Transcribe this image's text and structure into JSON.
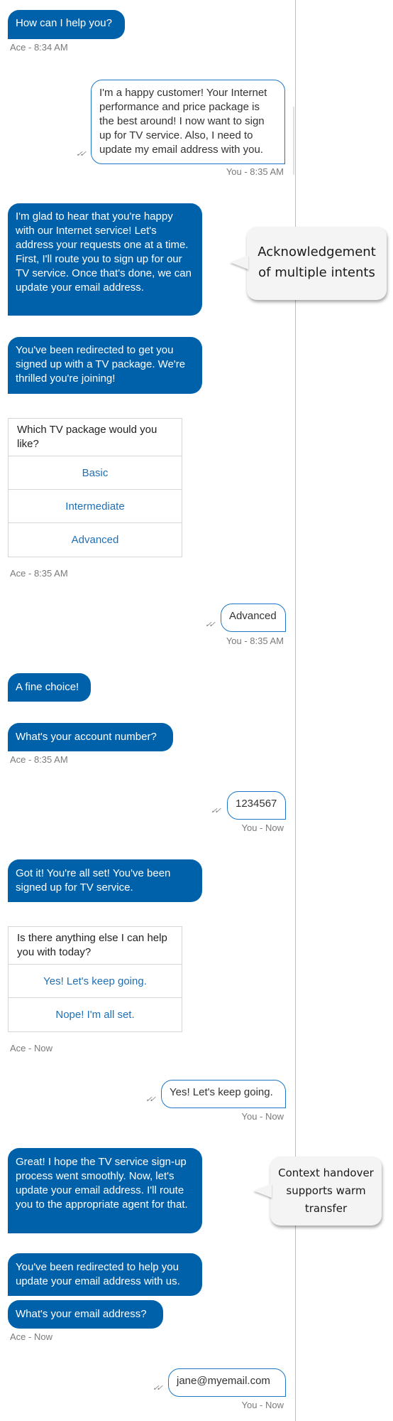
{
  "messages": {
    "m1": {
      "sender": "agent",
      "text": "How can I help you?",
      "meta": "Ace - 8:34 AM"
    },
    "m2": {
      "sender": "user",
      "text": "I'm a happy customer! Your Internet performance and price package is the best around! I now want to sign up for TV service. Also, I need to update my email address with you.",
      "meta": "You - 8:35 AM"
    },
    "m3": {
      "sender": "agent",
      "text": "I'm glad to hear that you're happy with our Internet service! Let's address your requests one at a time. First, I'll route you to sign up for our TV service. Once that's done, we can update your email address."
    },
    "m4": {
      "sender": "agent",
      "text": "You've been redirected to get you signed up with a TV package. We're thrilled you're joining!"
    },
    "card1": {
      "question": "Which TV package would you like?",
      "options": [
        "Basic",
        "Intermediate",
        "Advanced"
      ],
      "meta": "Ace - 8:35 AM"
    },
    "m5": {
      "sender": "user",
      "text": "Advanced",
      "meta": "You - 8:35 AM"
    },
    "m6": {
      "sender": "agent",
      "text": "A fine choice!"
    },
    "m7": {
      "sender": "agent",
      "text": "What's your account number?",
      "meta": "Ace - 8:35 AM"
    },
    "m8": {
      "sender": "user",
      "text": "1234567",
      "meta": "You - Now"
    },
    "m9": {
      "sender": "agent",
      "text": "Got it! You're all set! You've been signed up for TV service."
    },
    "card2": {
      "question": "Is there anything else I can help you with today?",
      "options": [
        "Yes! Let's keep going.",
        "Nope! I'm all set."
      ],
      "meta": "Ace - Now"
    },
    "m10": {
      "sender": "user",
      "text": "Yes! Let's keep going.",
      "meta": "You - Now"
    },
    "m11": {
      "sender": "agent",
      "text": "Great! I hope the TV service sign-up process went smoothly. Now, let's update your email address. I'll route you to the appropriate agent for that."
    },
    "m12": {
      "sender": "agent",
      "text": "You've been redirected to help you update your email address with us."
    },
    "m13": {
      "sender": "agent",
      "text": "What's your email address?",
      "meta": "Ace - Now"
    },
    "m14": {
      "sender": "user",
      "text": "jane@myemail.com",
      "meta": "You - Now"
    }
  },
  "read_receipt_icon": "double-check-icon",
  "annotations": {
    "a1": {
      "line1": "Acknowledgement",
      "line2": "of multiple intents"
    },
    "a2": {
      "line1": "Context handover",
      "line2": "supports warm",
      "line3": "transfer"
    }
  },
  "colors": {
    "agent_bubble": "#0061ab",
    "user_border": "#1f77c4",
    "option_text": "#1f6fb5",
    "meta_text": "#7a7a7a",
    "callout_bg": "#f4f4f5"
  }
}
